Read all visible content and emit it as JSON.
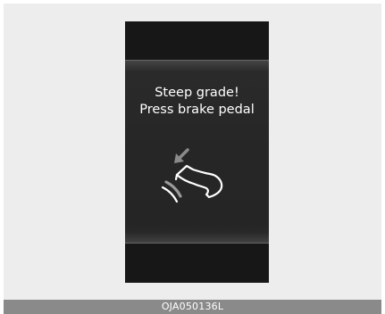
{
  "display": {
    "message_line1": "Steep grade!",
    "message_line2": "Press brake pedal",
    "icon": "brake-pedal-press-icon"
  },
  "caption": {
    "code": "OJA050136L"
  },
  "colors": {
    "background": "#ededed",
    "display": "#171717",
    "text": "#ffffff",
    "caption_bar": "#8a8a8a"
  }
}
